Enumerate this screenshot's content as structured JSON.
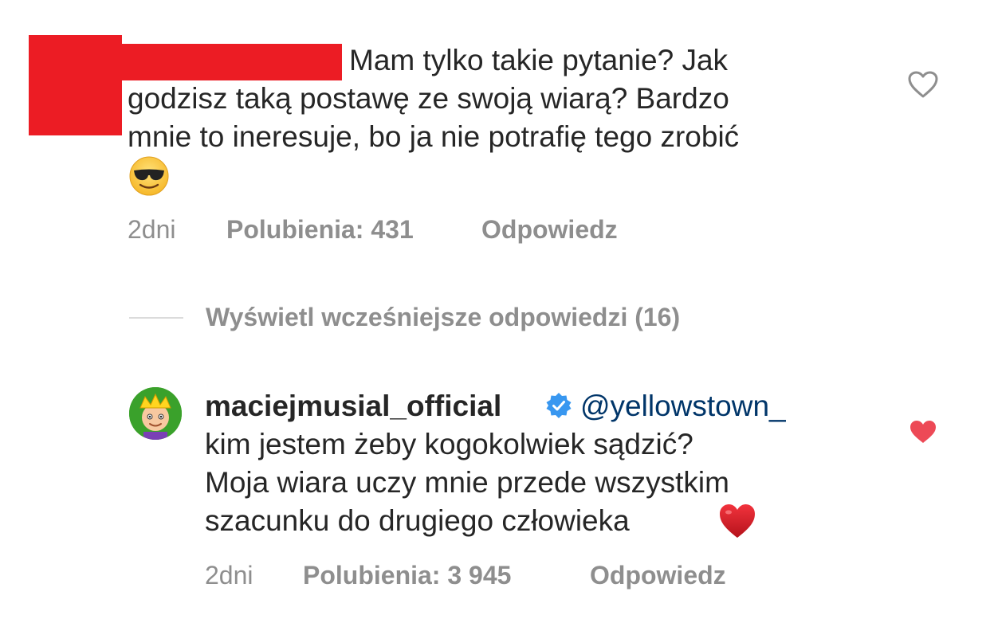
{
  "comments": [
    {
      "text_lines": [
        "Mam tylko takie pytanie? Jak",
        "godzisz taką postawę ze swoją wiarą? Bardzo",
        "mnie to ineresuje, bo ja nie potrafię tego zrobić"
      ],
      "emoji": "smiling-face-with-sunglasses",
      "time": "2dni",
      "likes_label": "Polubienia: 431",
      "reply_label": "Odpowiedz",
      "liked": false
    },
    {
      "username": "maciejmusial_official",
      "verified": true,
      "mention": "@yellowstown_",
      "text_lines": [
        "kim jestem żeby kogokolwiek sądzić?",
        "Moja wiara uczy mnie przede wszystkim",
        "szacunku do drugiego człowieka"
      ],
      "emoji": "red-heart",
      "time": "2dni",
      "likes_label": "Polubienia: 3 945",
      "reply_label": "Odpowiedz",
      "liked": true
    }
  ],
  "view_replies_label": "Wyświetl wcześniejsze odpowiedzi (16)",
  "colors": {
    "text": "#262626",
    "secondary": "#8e8e8e",
    "mention": "#003569",
    "like_red": "#ed4956",
    "verified_blue": "#3897f0",
    "redaction": "#ec1c24"
  }
}
